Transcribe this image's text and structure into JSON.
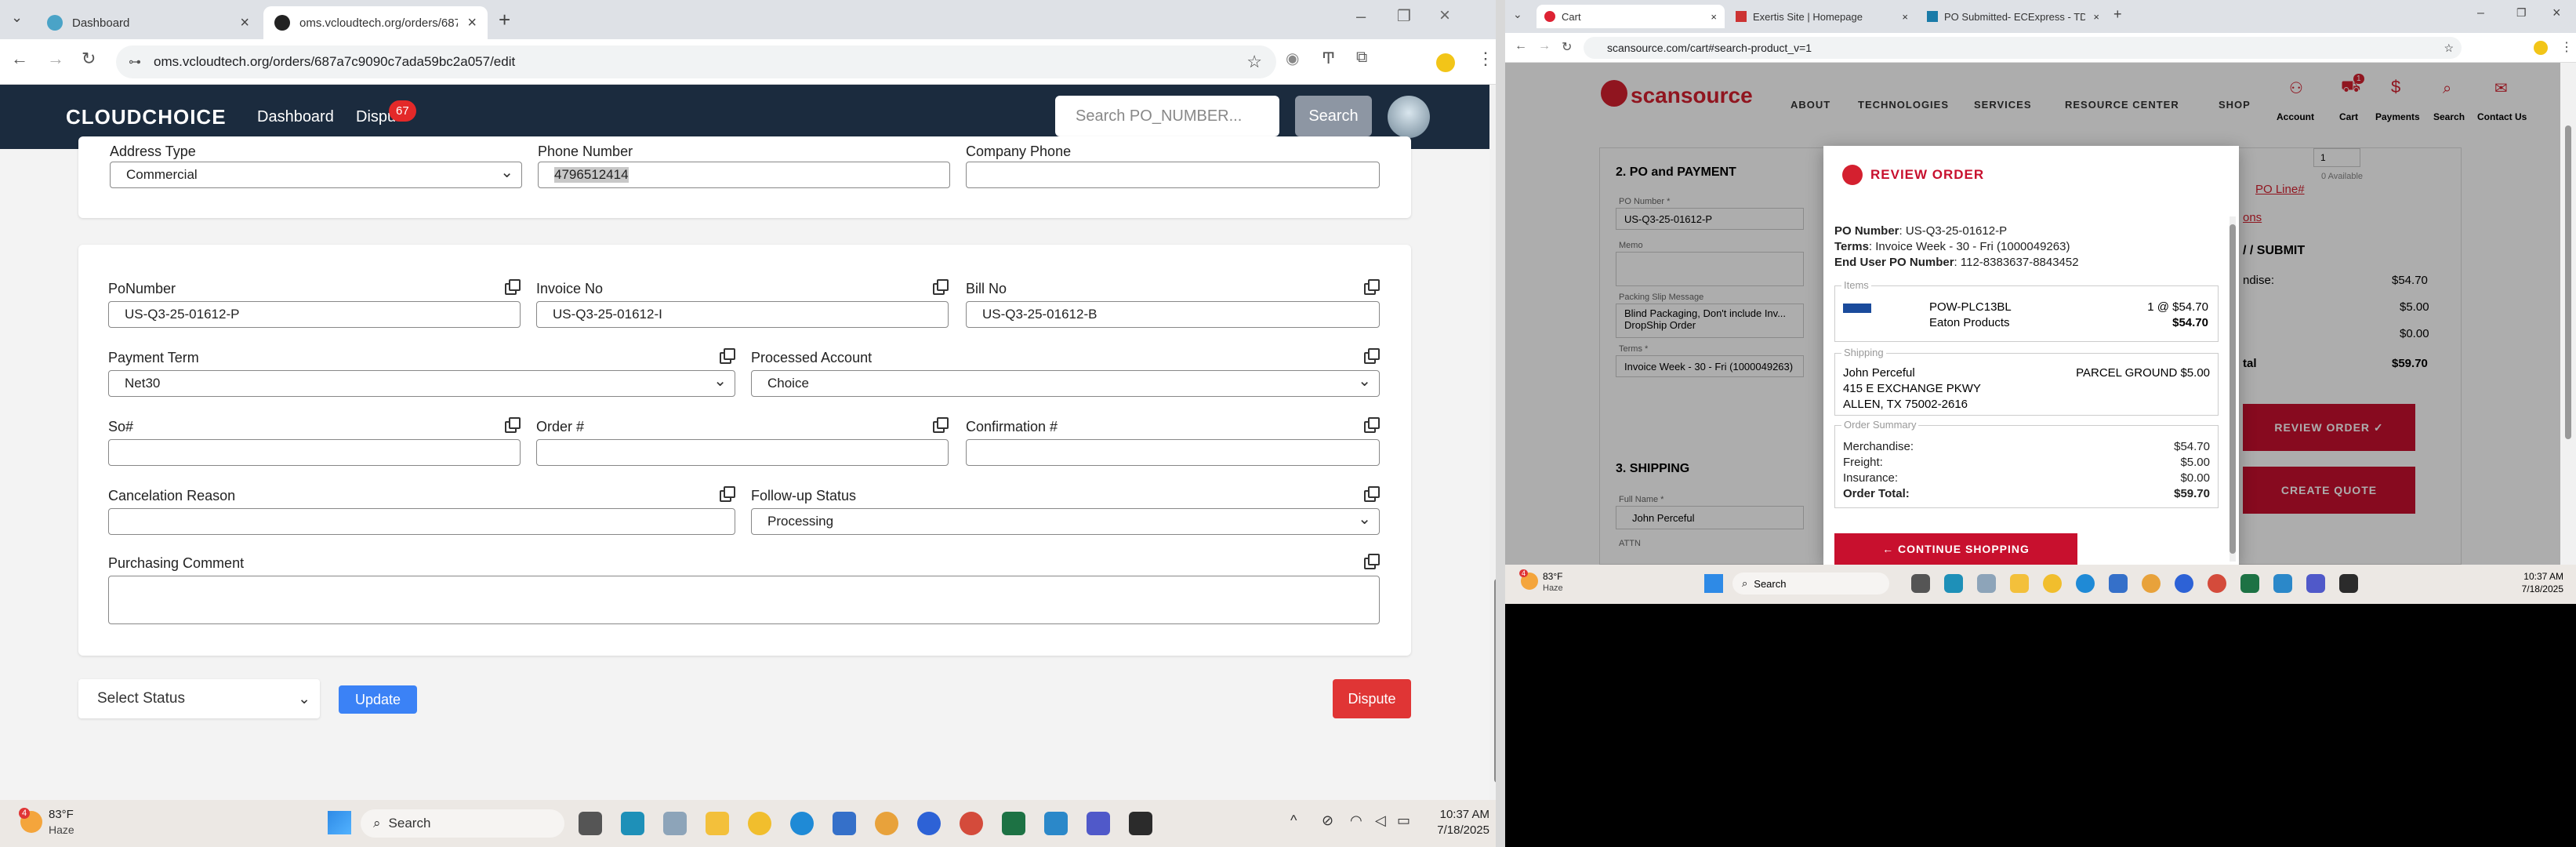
{
  "left_browser": {
    "tabs": [
      {
        "title": "Dashboard"
      },
      {
        "title": "oms.vcloudtech.org/orders/687"
      }
    ],
    "url": "oms.vcloudtech.org/orders/687a7c9090c7ada59bc2a057/edit"
  },
  "oms": {
    "brand": "CLOUDCHOICE",
    "nav": {
      "dashboard": "Dashboard",
      "disputes": "Dispu",
      "badge": "67"
    },
    "search_placeholder": "Search PO_NUMBER...",
    "search_button": "Search",
    "top": {
      "address_type_label": "Address Type",
      "address_type_value": "Commercial",
      "phone_label": "Phone Number",
      "phone_value": "4796512414",
      "company_phone_label": "Company Phone",
      "company_phone_value": ""
    },
    "fields": {
      "po_label": "PoNumber",
      "po_value": "US-Q3-25-01612-P",
      "invoice_label": "Invoice No",
      "invoice_value": "US-Q3-25-01612-I",
      "bill_label": "Bill No",
      "bill_value": "US-Q3-25-01612-B",
      "payment_term_label": "Payment Term",
      "payment_term_value": "Net30",
      "processed_account_label": "Processed Account",
      "processed_account_value": "Choice",
      "so_label": "So#",
      "so_value": "",
      "order_label": "Order #",
      "order_value": "",
      "confirmation_label": "Confirmation #",
      "confirmation_value": "",
      "cancel_reason_label": "Cancelation Reason",
      "cancel_reason_value": "",
      "followup_label": "Follow-up Status",
      "followup_value": "Processing",
      "comment_label": "Purchasing Comment",
      "comment_value": ""
    },
    "status_select": "Select Status",
    "update_button": "Update",
    "dispute_button": "Dispute"
  },
  "taskbar_left": {
    "temp": "83°F",
    "weather": "Haze",
    "weather_badge": "4",
    "search": "Search",
    "time": "10:37 AM",
    "date": "7/18/2025"
  },
  "right_browser": {
    "tabs": [
      {
        "title": "Cart"
      },
      {
        "title": "Exertis Site | Homepage"
      },
      {
        "title": "PO Submitted- ECExpress - TD"
      }
    ],
    "url": "scansource.com/cart#search-product_v=1"
  },
  "scansource": {
    "logo": "scansource",
    "nav": [
      "ABOUT",
      "TECHNOLOGIES",
      "SERVICES",
      "RESOURCE CENTER",
      "SHOP"
    ],
    "icons": [
      "Account",
      "Cart",
      "Payments",
      "Search",
      "Contact Us"
    ],
    "cart_badge": "1",
    "po_payment_title": "2. PO and PAYMENT",
    "po_number_label": "PO Number *",
    "po_number_value": "US-Q3-25-01612-P",
    "memo_label": "Memo",
    "packing_label": "Packing Slip Message",
    "packing_value": "Blind Packaging, Don't include Inv... DropShip Order",
    "terms_label": "Terms *",
    "terms_value": "Invoice Week - 30 - Fri (1000049263)",
    "shipping_title": "3. SHIPPING",
    "full_name_label": "Full Name *",
    "full_name_value": "John Perceful",
    "attn_label": "ATTN",
    "qty": "1",
    "available": "0 Available",
    "po_line_link": "PO Line#",
    "ons": "ons",
    "submit_title": "/ / SUBMIT",
    "summary": [
      {
        "label": "ndise:",
        "value": "$54.70"
      },
      {
        "label": "",
        "value": "$5.00"
      },
      {
        "label": "",
        "value": "$0.00"
      },
      {
        "label": "tal",
        "value": "$59.70"
      }
    ],
    "review_btn": "REVIEW ORDER ✓",
    "quote_btn": "CREATE QUOTE"
  },
  "modal": {
    "title": "REVIEW ORDER",
    "po_label": "PO Number",
    "po_value": "US-Q3-25-01612-P",
    "terms_label": "Terms",
    "terms_value": "Invoice Week - 30 - Fri (1000049263)",
    "enduser_label": "End User PO Number",
    "enduser_value": "112-8383637-8843452",
    "items_label": "Items",
    "item_sku": "POW-PLC13BL",
    "item_brand": "Eaton Products",
    "item_qty_price": "1 @ $54.70",
    "item_total": "$54.70",
    "shipping_label": "Shipping",
    "ship_name": "John Perceful",
    "ship_addr1": "415 E EXCHANGE PKWY",
    "ship_addr2": "ALLEN, TX 75002-2616",
    "ship_method": "PARCEL GROUND $5.00",
    "summary_label": "Order Summary",
    "summary": [
      {
        "label": "Merchandise:",
        "value": "$54.70"
      },
      {
        "label": "Freight:",
        "value": "$5.00"
      },
      {
        "label": "Insurance:",
        "value": "$0.00"
      },
      {
        "label": "Order Total:",
        "value": "$59.70"
      }
    ],
    "continue": "←  CONTINUE SHOPPING"
  },
  "taskbar_right": {
    "temp": "83°F",
    "weather": "Haze",
    "weather_badge": "4",
    "search": "Search",
    "time": "10:37 AM",
    "date": "7/18/2025"
  }
}
